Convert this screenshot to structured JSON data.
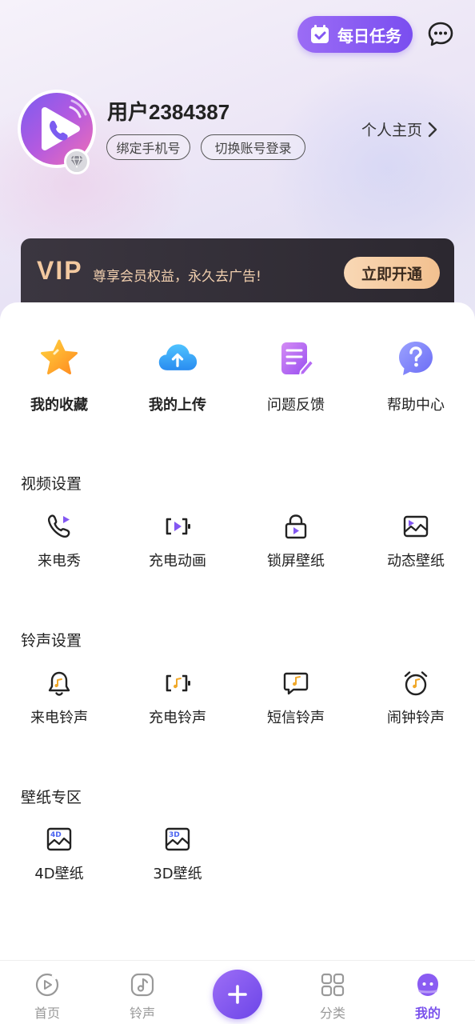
{
  "header": {
    "daily_task_label": "每日任务",
    "message_icon": "chat-bubble-icon"
  },
  "profile": {
    "username": "用户2384387",
    "bind_phone_label": "绑定手机号",
    "switch_account_label": "切换账号登录",
    "homepage_label": "个人主页"
  },
  "vip": {
    "logo": "VIP",
    "slogan": "尊享会员权益，永久去广告!",
    "open_label": "立即开通"
  },
  "quick_actions": [
    {
      "label": "我的收藏",
      "icon": "star-icon"
    },
    {
      "label": "我的上传",
      "icon": "cloud-upload-icon"
    },
    {
      "label": "问题反馈",
      "icon": "feedback-icon"
    },
    {
      "label": "帮助中心",
      "icon": "help-icon"
    }
  ],
  "sections": {
    "video": {
      "title": "视频设置",
      "items": [
        {
          "label": "来电秀",
          "icon": "phone-play-icon"
        },
        {
          "label": "充电动画",
          "icon": "charging-video-icon"
        },
        {
          "label": "锁屏壁纸",
          "icon": "lock-play-icon"
        },
        {
          "label": "动态壁纸",
          "icon": "live-wallpaper-icon"
        }
      ]
    },
    "ringtone": {
      "title": "铃声设置",
      "items": [
        {
          "label": "来电铃声",
          "icon": "bell-icon"
        },
        {
          "label": "充电铃声",
          "icon": "charging-music-icon"
        },
        {
          "label": "短信铃声",
          "icon": "sms-music-icon"
        },
        {
          "label": "闹钟铃声",
          "icon": "alarm-icon"
        }
      ]
    },
    "wallpaper": {
      "title": "壁纸专区",
      "items": [
        {
          "label": "4D壁纸",
          "icon": "4d-wallpaper-icon",
          "badge": "4D"
        },
        {
          "label": "3D壁纸",
          "icon": "3d-wallpaper-icon",
          "badge": "3D"
        }
      ]
    }
  },
  "tabbar": [
    {
      "label": "首页",
      "icon": "home-play-icon"
    },
    {
      "label": "铃声",
      "icon": "music-note-icon"
    },
    {
      "label": "",
      "icon": "plus-icon"
    },
    {
      "label": "分类",
      "icon": "grid-icon"
    },
    {
      "label": "我的",
      "icon": "profile-icon",
      "active": true
    }
  ],
  "colors": {
    "accent": "#7a52ec",
    "vip_gold": "#f3c9a0",
    "vip_dark": "#2f2b33"
  }
}
